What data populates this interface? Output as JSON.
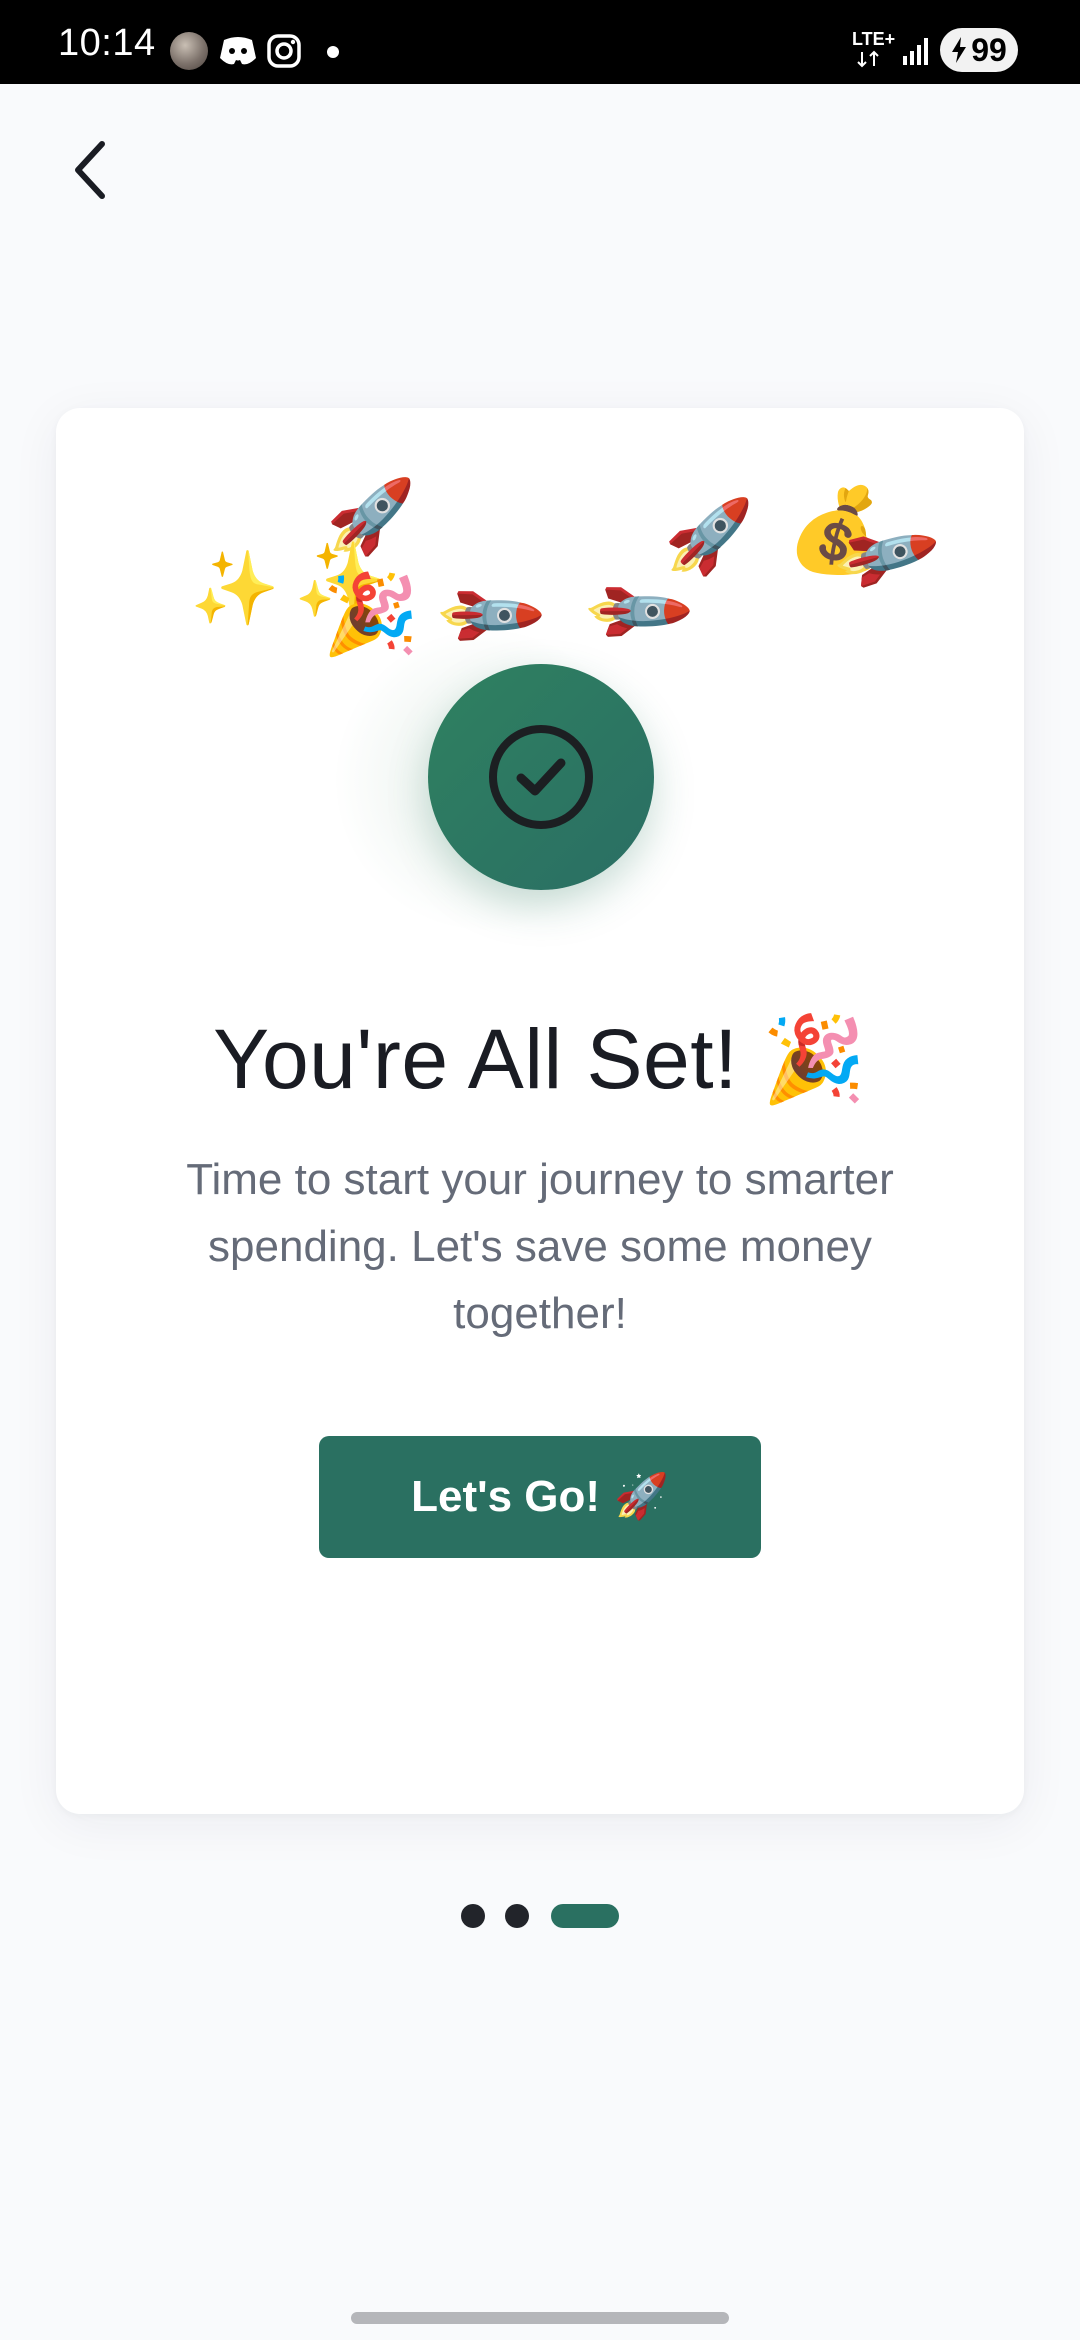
{
  "status_bar": {
    "time": "10:14",
    "network": "LTE+",
    "battery_level": "99"
  },
  "navigation": {
    "back_icon": "chevron-left-icon"
  },
  "decorations": {
    "rocket": "🚀",
    "sparkles": "✨",
    "party_popper": "🎉",
    "money_bag": "💰"
  },
  "card": {
    "icon": "check-circle-icon",
    "title": "You're All Set!",
    "title_emoji": "🎉",
    "subtitle": "Time to start your journey to smarter spending. Let's save some money together!",
    "cta_label": "Let's Go!",
    "cta_emoji": "🚀"
  },
  "pager": {
    "total": 3,
    "active_index": 2
  },
  "colors": {
    "accent": "#2a7061",
    "check_gradient_start": "#2f8160",
    "title_text": "#1a1c23",
    "subtitle_text": "#656b78",
    "background": "#f9fafc"
  }
}
